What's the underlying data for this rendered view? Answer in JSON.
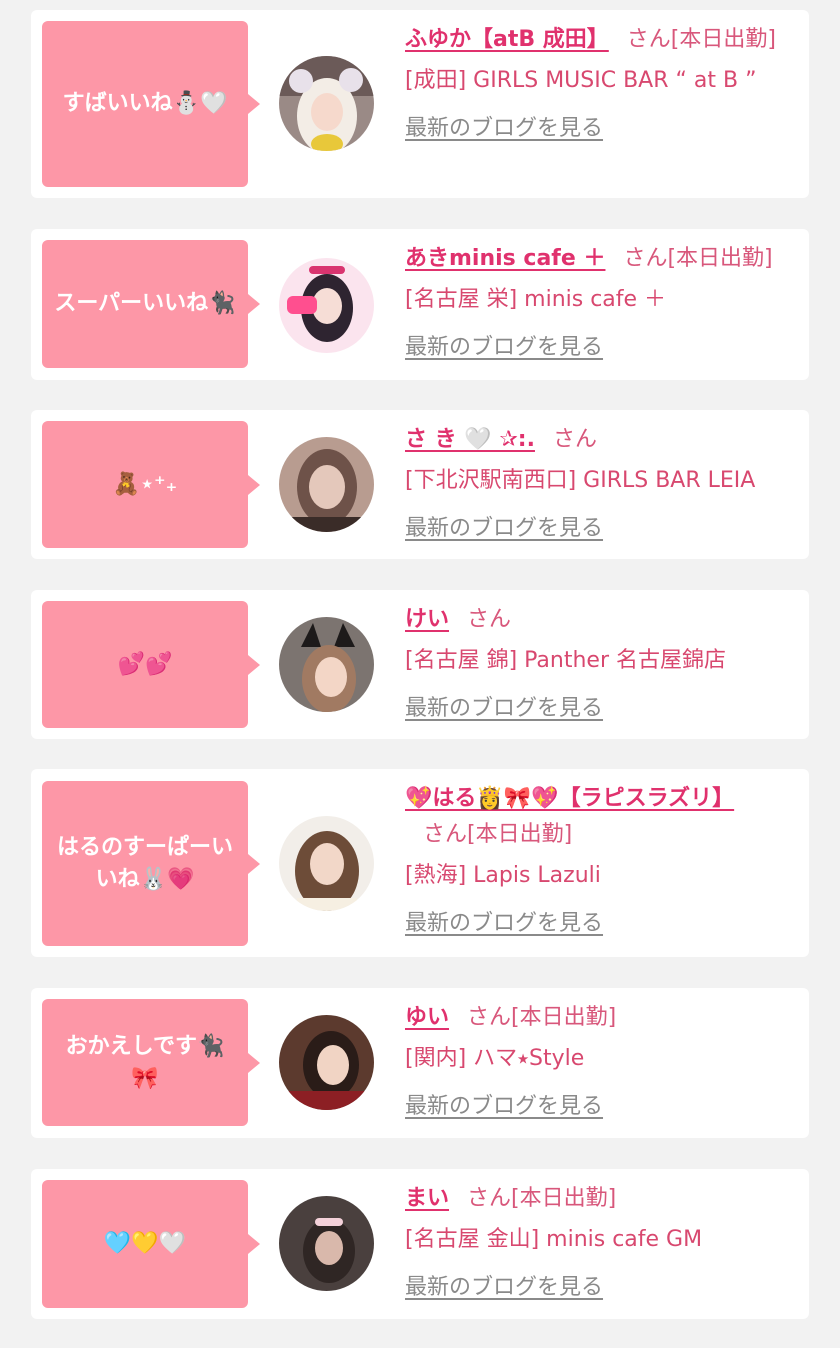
{
  "blog_link_label": "最新のブログを見る",
  "colors": {
    "background": "#f2f2f2",
    "card": "#ffffff",
    "bubble": "#fd97a7",
    "name_link": "#e0316d",
    "shop_text": "#d8486f",
    "blog_link": "#8a8a8a"
  },
  "entries": [
    {
      "bubble": "すばいいね⛄🤍",
      "name": "ふゆか【atB 成田】",
      "suffix": "さん[本日出勤]",
      "shop": "[成田] GIRLS MUSIC BAR “ at B ”",
      "avatar_icon": "girl-photo-blonde-bear-ears"
    },
    {
      "bubble": "スーパーいいね🐈‍⬛",
      "name": "あきminis cafe ＋",
      "suffix": "さん[本日出勤]",
      "shop": "[名古屋 栄] minis cafe ＋",
      "avatar_icon": "girl-photo-pink-frame"
    },
    {
      "bubble": "🧸⋆⁺₊",
      "name": "さ き 🤍 ✰:.",
      "suffix": "さん",
      "shop": "[下北沢駅南西口] GIRLS BAR LEIA",
      "avatar_icon": "girl-photo-blurred"
    },
    {
      "bubble": "💕💕",
      "name": "けい",
      "suffix": "さん",
      "shop": "[名古屋 錦] Panther 名古屋錦店",
      "avatar_icon": "girl-photo-cat-ears"
    },
    {
      "bubble": "はるのすーぱーいいね🐰💗",
      "name": "💖はる👸🎀💖【ラピスラズリ】",
      "suffix": "さん[本日出勤]",
      "shop": "[熱海] Lapis Lazuli",
      "avatar_icon": "girl-photo-long-hair"
    },
    {
      "bubble": "おかえしです🐈‍⬛🎀",
      "name": "ゆい",
      "suffix": "さん[本日出勤]",
      "shop": "[関内] ハマ⭑Style",
      "avatar_icon": "girl-photo-red-outfit"
    },
    {
      "bubble": "🩵💛🤍",
      "name": "まい",
      "suffix": "さん[本日出勤]",
      "shop": "[名古屋 金山] minis cafe GM",
      "avatar_icon": "girl-photo-dark"
    }
  ]
}
